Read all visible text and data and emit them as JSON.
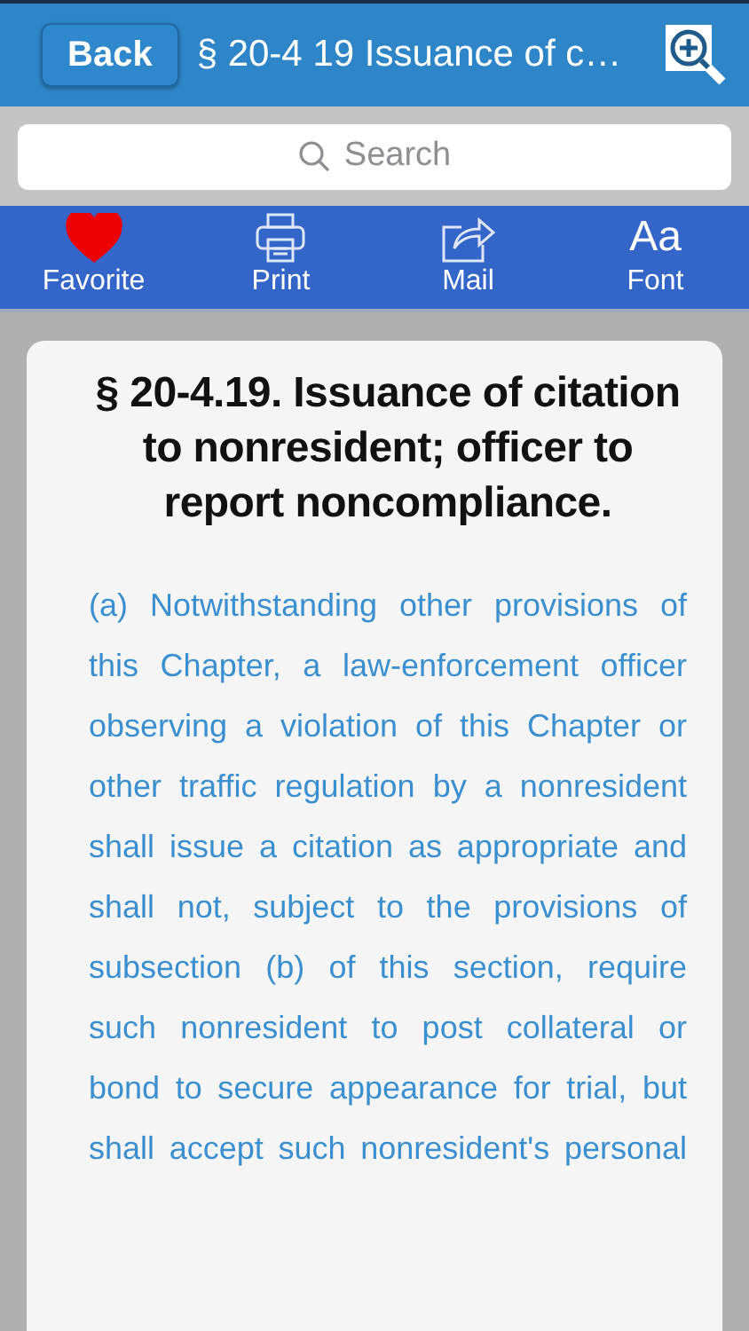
{
  "nav_bar": {
    "back_label": "Back",
    "title": "§ 20-4 19 Issuance of c…"
  },
  "search": {
    "placeholder": "Search"
  },
  "toolbar": [
    {
      "label": "Favorite",
      "kind": "heart",
      "on": true
    },
    {
      "label": "Print",
      "kind": "printer",
      "on": false
    },
    {
      "label": "Mail",
      "kind": "share",
      "on": false
    },
    {
      "label": "Font",
      "kind": "font",
      "on": false,
      "glyph": "Aa"
    }
  ],
  "article": {
    "heading": "§ 20-4.19. Issuance of citation to nonresident; officer to report noncompliance.",
    "body": "(a) Notwithstanding other provisions of this Chapter, a law-enforcement officer observing a violation of this Chapter or other traffic regulation by a nonresident shall issue a citation as appropriate and shall not, subject to the provisions of subsection (b) of this section, require such nonresident to post collateral or bond to secure appearance for trial, but shall accept such nonresident's personal"
  }
}
